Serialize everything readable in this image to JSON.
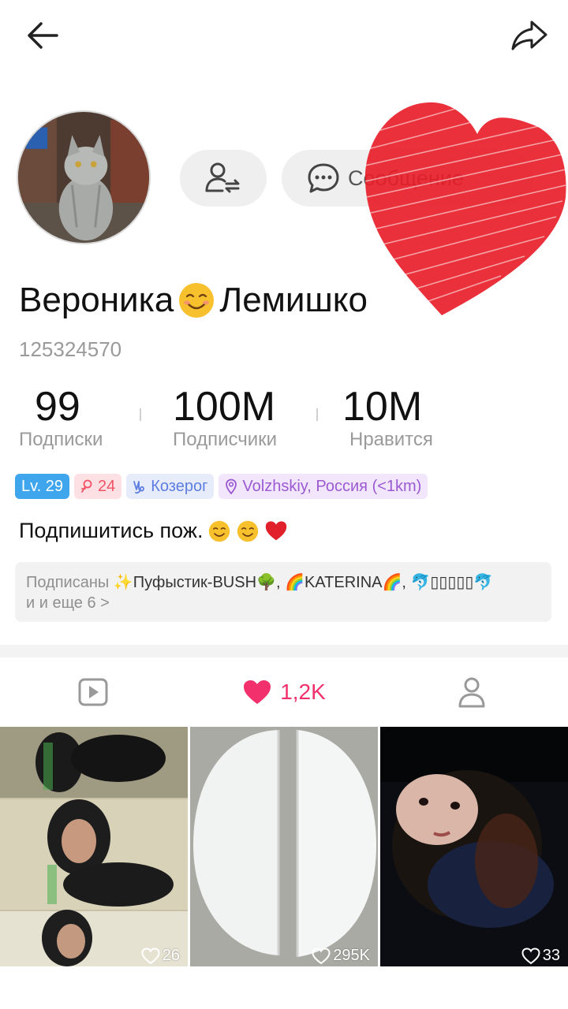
{
  "profile": {
    "name_first": "Вероника",
    "name_last": "Лемишко",
    "user_id": "125324570",
    "bio_text": "Подпишитись пож."
  },
  "actions": {
    "message_label": "Сообщение"
  },
  "stats": [
    {
      "value": "99",
      "label": "Подписки"
    },
    {
      "value": "100M",
      "label": "Подписчики"
    },
    {
      "value": "10M",
      "label": "Нравится"
    }
  ],
  "chips": {
    "level": "Lv. 29",
    "age": "24",
    "zodiac": "Козерог",
    "location": "Volzhskiy, Россия (<1km)"
  },
  "followed_by": {
    "prefix": "Подписаны",
    "names": "✨Пуфыстик-BUSH🌳, 🌈KATERINA🌈, 🐬▯▯▯▯▯🐬",
    "more": "и и еще 6 >"
  },
  "tabs": {
    "likes_count": "1,2K"
  },
  "grid": [
    {
      "likes": "26"
    },
    {
      "likes": "295K"
    },
    {
      "likes": "33"
    }
  ],
  "icons": {
    "back": "arrow-left-icon",
    "share": "share-icon",
    "follow": "user-follow-icon",
    "message": "chat-bubble-icon",
    "videos_tab": "play-icon",
    "likes_tab": "heart-icon",
    "profile_tab": "person-icon"
  },
  "colors": {
    "accent": "#f1306c",
    "level_chip": "#3fa6ee"
  }
}
